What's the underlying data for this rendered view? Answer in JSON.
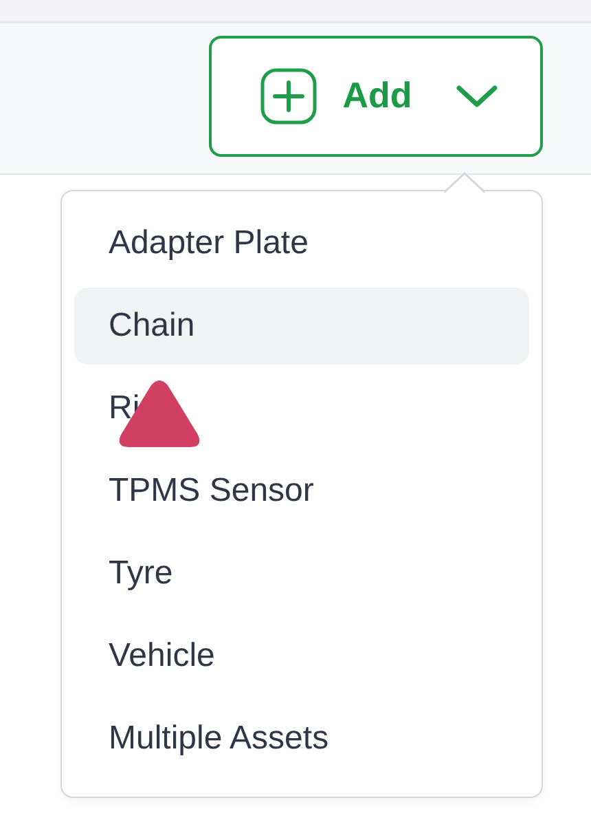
{
  "add_button": {
    "label": "Add",
    "expanded": true
  },
  "menu": {
    "items": [
      {
        "label": "Adapter Plate",
        "selected": false
      },
      {
        "label": "Chain",
        "selected": true
      },
      {
        "label": "Ri",
        "selected": false,
        "covered": true
      },
      {
        "label": "TPMS Sensor",
        "selected": false
      },
      {
        "label": "Tyre",
        "selected": false
      },
      {
        "label": "Vehicle",
        "selected": false
      },
      {
        "label": "Multiple Assets",
        "selected": false
      }
    ]
  }
}
